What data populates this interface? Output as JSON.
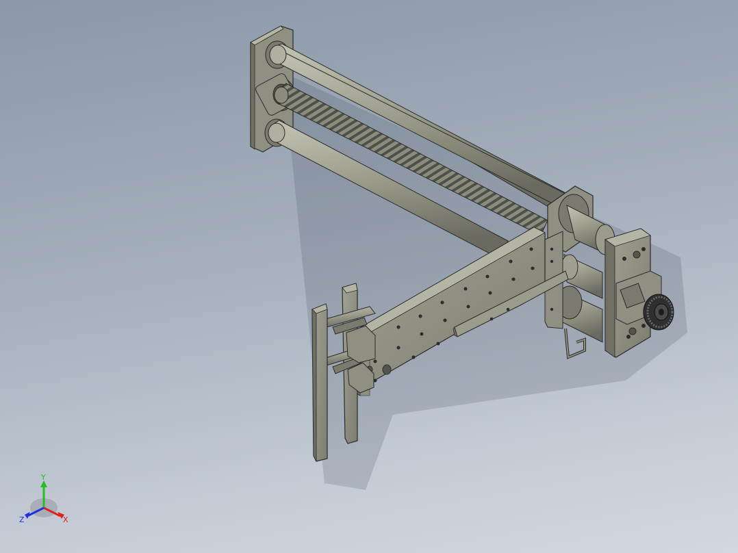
{
  "viewport": {
    "background_top": "#8c98a8",
    "background_bottom": "#d2d8e0"
  },
  "model": {
    "body_color": "#8f8f82",
    "body_light": "#b5b5a6",
    "body_dark": "#5f5f56",
    "edge_color": "#2b2b2b",
    "pulley_color": "#3a3a3a"
  },
  "triad": {
    "x_label": "X",
    "y_label": "Y",
    "z_label": "Z",
    "x_color": "#e02020",
    "y_color": "#20c020",
    "z_color": "#2030e0"
  }
}
